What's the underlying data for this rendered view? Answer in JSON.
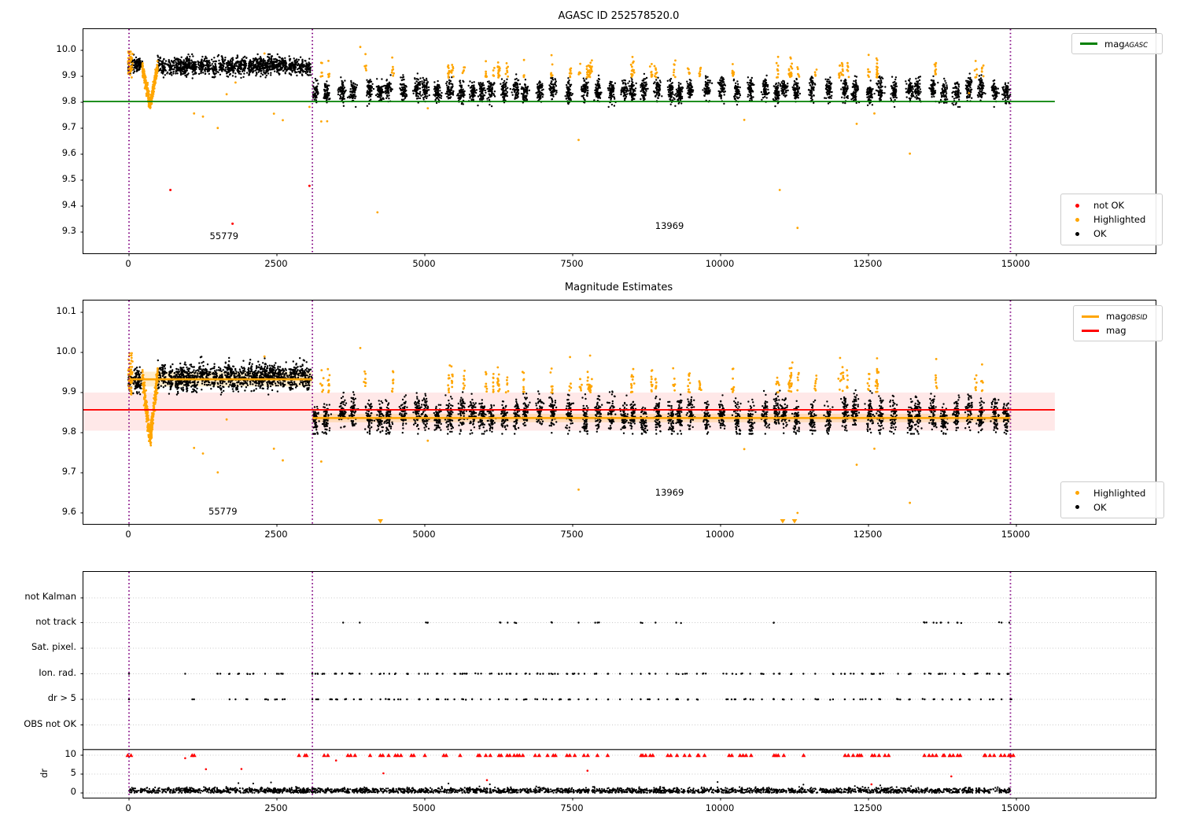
{
  "colors": {
    "ok": "#000000",
    "highlighted": "#ffa500",
    "not_ok": "#ff0000",
    "mag_agasc_line": "#008000",
    "mag_obsid_line": "#ffa500",
    "mag_line": "#ff0000",
    "vline": "#800080",
    "band_pink": "rgba(255,0,0,0.09)",
    "band_orange": "rgba(255,165,0,0.20)",
    "grid": "#c9c9c9",
    "divider": "#000000"
  },
  "chart_data": [
    {
      "id": "agasc_mag",
      "type": "scatter",
      "title": "AGASC ID 252578520.0",
      "x_ticks": [
        "0",
        "2500",
        "5000",
        "7500",
        "10000",
        "12500",
        "15000"
      ],
      "x_tick_values": [
        0,
        2500,
        5000,
        7500,
        10000,
        12500,
        15000
      ],
      "y_ticks": [
        "10.0",
        "9.9",
        "9.8",
        "9.7",
        "9.6",
        "9.5",
        "9.4",
        "9.3"
      ],
      "y_tick_values": [
        10.0,
        9.9,
        9.8,
        9.7,
        9.6,
        9.5,
        9.4,
        9.3
      ],
      "xlim": [
        -771,
        17350
      ],
      "ylim": [
        9.218,
        10.082
      ],
      "vlines": [
        0,
        3100,
        14900
      ],
      "agasc_line": {
        "value": 9.803,
        "x_end": 15650
      },
      "legend_line": {
        "label_main": "mag",
        "label_sub": "AGASC"
      },
      "legend_points": [
        {
          "label": "not OK",
          "color_key": "not_ok"
        },
        {
          "label": "Highlighted",
          "color_key": "highlighted"
        },
        {
          "label": "OK",
          "color_key": "ok"
        }
      ],
      "annotations": [
        {
          "text": "55779",
          "x": 1620,
          "y": 9.282
        },
        {
          "text": "13969",
          "x": 9150,
          "y": 9.321
        }
      ],
      "series": {
        "seg1": {
          "x": [
            -15,
            3100
          ],
          "n": 1650,
          "mean": 9.938,
          "sd": 0.016,
          "clip": [
            9.887,
            9.985
          ]
        },
        "dip": {
          "x": [
            225,
            485
          ],
          "center": 355,
          "min": 9.79,
          "edge": 9.935,
          "n": 300,
          "sd": 0.014
        },
        "start_orange": {
          "x": [
            -15,
            60
          ],
          "n": 45,
          "mean": 9.95,
          "sd": 0.028,
          "clip": [
            9.875,
            9.995
          ]
        },
        "seg2": {
          "x": [
            3110,
            14900
          ],
          "n": 3600,
          "mean": 9.845,
          "sd": 0.021,
          "clip": [
            9.782,
            9.922
          ]
        },
        "spikes": {
          "n": 42,
          "ymin": 9.895,
          "ymax": 9.995
        },
        "orange_outliers": [
          [
            1100,
            9.757
          ],
          [
            1250,
            9.745
          ],
          [
            1500,
            9.701
          ],
          [
            1650,
            9.831
          ],
          [
            1800,
            9.876
          ],
          [
            2290,
            9.988
          ],
          [
            2450,
            9.756
          ],
          [
            2600,
            9.731
          ],
          [
            3050,
            9.782
          ],
          [
            3250,
            9.726
          ],
          [
            3350,
            9.727
          ],
          [
            3910,
            10.013
          ],
          [
            4200,
            9.376
          ],
          [
            5050,
            9.777
          ],
          [
            7600,
            9.655
          ],
          [
            10400,
            9.732
          ],
          [
            11000,
            9.462
          ],
          [
            11300,
            9.316
          ],
          [
            12300,
            9.717
          ],
          [
            12600,
            9.757
          ],
          [
            13200,
            9.602
          ],
          [
            14200,
            9.835
          ]
        ],
        "not_ok_points": [
          [
            700,
            9.462
          ],
          [
            1750,
            9.332
          ],
          [
            3050,
            9.478
          ]
        ]
      }
    },
    {
      "id": "magnitude_estimates",
      "type": "scatter",
      "title": "Magnitude Estimates",
      "x_ticks": [
        "0",
        "2500",
        "5000",
        "7500",
        "10000",
        "12500",
        "15000"
      ],
      "x_tick_values": [
        0,
        2500,
        5000,
        7500,
        10000,
        12500,
        15000
      ],
      "y_ticks": [
        "10.1",
        "10.0",
        "9.9",
        "9.8",
        "9.7",
        "9.6"
      ],
      "y_tick_values": [
        10.1,
        10.0,
        9.9,
        9.8,
        9.7,
        9.6
      ],
      "xlim": [
        -771,
        17350
      ],
      "ylim": [
        9.573,
        10.129
      ],
      "vlines": [
        0,
        3100,
        14900
      ],
      "mag_line": {
        "value": 9.857,
        "band": [
          9.805,
          9.9
        ],
        "x_end": 15650
      },
      "obsid_segments": [
        {
          "x": [
            0,
            3100
          ],
          "value": 9.933,
          "band": [
            9.915,
            9.952
          ]
        },
        {
          "x": [
            3100,
            14900
          ],
          "value": 9.8365,
          "band": [
            9.826,
            9.847
          ]
        }
      ],
      "legend_lines": [
        {
          "label_main": "mag",
          "label_sub": "OBSID",
          "color_key": "mag_obsid_line"
        },
        {
          "label_main": "mag",
          "label_sub": "",
          "color_key": "mag_line"
        }
      ],
      "legend_points": [
        {
          "label": "Highlighted",
          "color_key": "highlighted"
        },
        {
          "label": "OK",
          "color_key": "ok"
        }
      ],
      "annotations": [
        {
          "text": "55779",
          "x": 1600,
          "y": 9.602
        },
        {
          "text": "13969",
          "x": 9150,
          "y": 9.649
        }
      ],
      "series": {
        "seg1": {
          "x": [
            -15,
            3100
          ],
          "n": 1650,
          "mean": 9.94,
          "sd": 0.015,
          "clip": [
            9.895,
            9.99
          ]
        },
        "dip": {
          "x": [
            225,
            485
          ],
          "center": 355,
          "min": 9.787,
          "edge": 9.937,
          "n": 320,
          "sd": 0.014
        },
        "start_orange": {
          "x": [
            -15,
            60
          ],
          "n": 45,
          "mean": 9.952,
          "sd": 0.028,
          "clip": [
            9.88,
            9.998
          ]
        },
        "seg2": {
          "x": [
            3110,
            14900
          ],
          "n": 3600,
          "mean": 9.843,
          "sd": 0.02,
          "clip": [
            9.797,
            9.923
          ]
        },
        "spikes": {
          "n": 42,
          "ymin": 9.9,
          "ymax": 9.998
        },
        "orange_outliers": [
          [
            1100,
            9.762
          ],
          [
            1250,
            9.748
          ],
          [
            1500,
            9.701
          ],
          [
            1650,
            9.833
          ],
          [
            2290,
            9.99
          ],
          [
            2450,
            9.76
          ],
          [
            2600,
            9.731
          ],
          [
            3250,
            9.728
          ],
          [
            3910,
            10.011
          ],
          [
            5050,
            9.78
          ],
          [
            7600,
            9.658
          ],
          [
            10400,
            9.759
          ],
          [
            11300,
            9.6
          ],
          [
            12300,
            9.72
          ],
          [
            12600,
            9.76
          ],
          [
            13200,
            9.625
          ],
          [
            14200,
            9.84
          ]
        ],
        "clip_triangles_x": [
          4250,
          11050,
          11250
        ]
      }
    },
    {
      "id": "flags_dr",
      "type": "scatter",
      "x_ticks": [
        "0",
        "2500",
        "5000",
        "7500",
        "10000",
        "12500",
        "15000"
      ],
      "x_tick_values": [
        0,
        2500,
        5000,
        7500,
        10000,
        12500,
        15000
      ],
      "flag_rows": [
        "not Kalman",
        "not track",
        "Sat. pixel.",
        "Ion. rad.",
        "dr > 5",
        "OBS not OK"
      ],
      "dr_axis": {
        "label": "dr",
        "ticks": [
          "10",
          "5",
          "0"
        ],
        "tick_values": [
          10,
          5,
          0
        ]
      },
      "vlines": [
        0,
        3100,
        14900
      ],
      "not_track_x": [
        3620,
        3900,
        5050,
        6280,
        6400,
        6520,
        7150,
        7600,
        7920,
        8650,
        8900,
        9250,
        10900,
        13450,
        13600,
        13720,
        13850,
        14000,
        14750,
        14880
      ],
      "ion_rad_x": [
        0,
        950,
        1500,
        1700,
        1850,
        2000,
        2100,
        2300,
        2500,
        2600,
        3100,
        3150,
        3300,
        3500,
        3600,
        3750,
        3900,
        4100,
        4250,
        4400,
        4500,
        4700,
        4900,
        5050,
        5200,
        5300,
        5500,
        5600,
        5700,
        5900,
        6100,
        6250,
        6300,
        6450,
        6550,
        6700,
        6900,
        7000,
        7100,
        7200,
        7400,
        7500,
        7600,
        7700,
        7900,
        8100,
        8300,
        8500,
        8650,
        8800,
        8900,
        9100,
        9250,
        9400,
        9600,
        9700,
        10100,
        10200,
        10350,
        10500,
        10700,
        10900,
        11000,
        11200,
        11400,
        11600,
        11900,
        12100,
        12250,
        12400,
        12550,
        12700,
        13000,
        13200,
        13450,
        13550,
        13700,
        13800,
        13950,
        14100,
        14300,
        14500,
        14700,
        14850
      ],
      "dr_gt5_x": [
        0,
        1100,
        1700,
        1800,
        2000,
        2300,
        2500,
        2600,
        3100,
        3200,
        3400,
        3500,
        3650,
        3800,
        3900,
        4100,
        4250,
        4400,
        4550,
        4700,
        4900,
        5050,
        5200,
        5350,
        5500,
        5650,
        5800,
        5950,
        6100,
        6250,
        6400,
        6550,
        6700,
        6900,
        7050,
        7150,
        7300,
        7450,
        7600,
        7750,
        7900,
        8100,
        8300,
        8500,
        8650,
        8800,
        8950,
        9100,
        9250,
        9450,
        9600,
        10100,
        10250,
        10400,
        10550,
        10700,
        10900,
        11050,
        11200,
        11400,
        11650,
        11900,
        12100,
        12250,
        12400,
        12550,
        12700,
        13000,
        13200,
        13450,
        13600,
        13750,
        13900,
        14050,
        14200,
        14400,
        14600,
        14750,
        14900
      ],
      "dr_clip_x": [
        0,
        1050,
        2900,
        3300,
        3700,
        4050,
        4250,
        4500,
        4750,
        5000,
        5300,
        5600,
        5900,
        6100,
        6250,
        6400,
        6550,
        6900,
        7100,
        7400,
        7550,
        7700,
        7900,
        8100,
        8650,
        8800,
        9100,
        9250,
        9400,
        9600,
        10150,
        10300,
        10450,
        10900,
        11050,
        11400,
        12100,
        12250,
        12400,
        12550,
        12700,
        13450,
        13600,
        13750,
        13900,
        14050,
        14450,
        14600,
        14750,
        14900
      ],
      "dr_red_points": [
        [
          950,
          9.2
        ],
        [
          1300,
          6.3
        ],
        [
          1900,
          6.35
        ],
        [
          3500,
          8.6
        ],
        [
          4300,
          5.2
        ],
        [
          6050,
          3.4
        ],
        [
          7750,
          5.9
        ],
        [
          12550,
          2.3
        ],
        [
          13900,
          4.4
        ]
      ],
      "dr_black_spikes": [
        [
          1850,
          2.6
        ],
        [
          2100,
          2.5
        ],
        [
          2400,
          2.8
        ],
        [
          5400,
          2.5
        ],
        [
          6100,
          2.3
        ],
        [
          9950,
          2.9
        ],
        [
          11400,
          2.2
        ],
        [
          12700,
          2.0
        ]
      ],
      "dr_series": {
        "x": [
          0,
          14900
        ],
        "n": 2600,
        "mean": 0.6,
        "sd": 0.4,
        "clip": [
          0.04,
          2.9
        ]
      },
      "divider_dr": 11.5
    }
  ]
}
